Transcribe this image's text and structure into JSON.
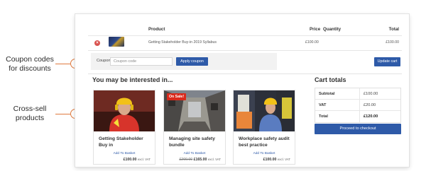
{
  "callouts": {
    "coupon": "Coupon codes for discounts",
    "cross_sell": "Cross-sell products"
  },
  "cart": {
    "headers": {
      "product": "Product",
      "price": "Price",
      "quantity": "Quantity",
      "total": "Total"
    },
    "items": [
      {
        "remove": "×",
        "name": "Getting Stakeholder Buy-in 2019 Syllabus",
        "price": "£100.00",
        "total": "£100.00"
      }
    ]
  },
  "coupon": {
    "label": "Coupon:",
    "placeholder": "Coupon code",
    "apply_label": "Apply coupon",
    "update_label": "Update cart"
  },
  "cross_sells": {
    "title": "You may be interested in...",
    "products": [
      {
        "title": "Getting Stakeholder Buy in",
        "link": "Add To Basket",
        "price": "£100.00",
        "price_suffix": "excl. VAT",
        "badge": ""
      },
      {
        "title": "Managing site safety bundle",
        "link": "Add To Basket",
        "old_price": "£200.00",
        "price": "£165.00",
        "price_suffix": "excl. VAT",
        "badge": "On Sale!"
      },
      {
        "title": "Workplace safety audit best practice",
        "link": "Add To Basket",
        "price": "£100.00",
        "price_suffix": "excl. VAT",
        "badge": ""
      }
    ]
  },
  "totals": {
    "title": "Cart totals",
    "rows": [
      {
        "label": "Subtotal",
        "value": "£100.00"
      },
      {
        "label": "VAT",
        "value": "£20.00"
      },
      {
        "label": "Total",
        "value": "£120.00"
      }
    ],
    "checkout_label": "Proceed to checkout"
  },
  "colors": {
    "accent": "#2e5aa8",
    "sale": "#d9291c",
    "callout": "#e07a3e"
  }
}
